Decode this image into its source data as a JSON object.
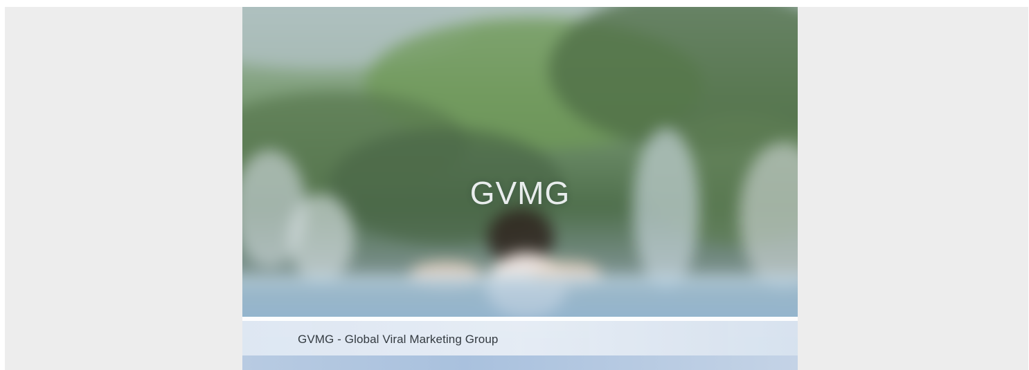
{
  "hero": {
    "title": "GVMG"
  },
  "caption": {
    "text": "GVMG - Global Viral Marketing Group"
  },
  "colors": {
    "page_background": "#ededed",
    "caption_background": "#e4ebf4",
    "caption_text": "#333a40",
    "title_text": "#f5f7fa"
  }
}
